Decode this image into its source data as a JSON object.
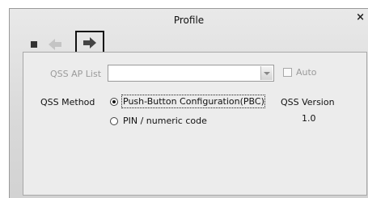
{
  "window": {
    "title": "Profile",
    "close_glyph": "×"
  },
  "toolbar": {
    "icons": [
      "stop-icon",
      "back-arrow-icon",
      "forward-arrow-icon"
    ]
  },
  "form": {
    "qss_ap_list_label": "QSS AP List",
    "qss_ap_list_value": "",
    "auto_label": "Auto",
    "auto_checked": false,
    "qss_method_label": "QSS Method",
    "pbc_label": "Push-Button Configuration(PBC)",
    "pbc_selected": true,
    "pin_label": "PIN / numeric code",
    "pin_selected": false,
    "qss_version_label": "QSS Version",
    "qss_version_value": "1.0"
  },
  "colors": {
    "disabled_text": "#9a9a9a",
    "window_bg": "#dcdcdc",
    "panel_bg": "#ececec"
  }
}
